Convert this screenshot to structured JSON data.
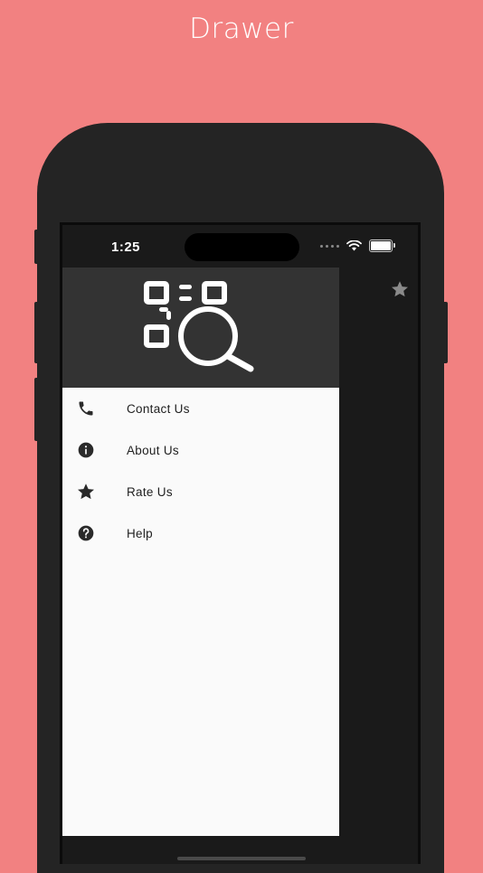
{
  "caption": "Drawer",
  "status_bar": {
    "time": "1:25"
  },
  "header": {
    "logo_icon": "qr-search-icon"
  },
  "menu": {
    "items": [
      {
        "label": "Contact Us",
        "icon": "phone-icon"
      },
      {
        "label": "About Us",
        "icon": "info-icon"
      },
      {
        "label": "Rate Us",
        "icon": "star-icon"
      },
      {
        "label": "Help",
        "icon": "help-icon"
      }
    ]
  },
  "colors": {
    "background": "#f28181",
    "drawer_header": "#333333",
    "drawer_body": "#fafafa",
    "app_background": "#1a1a1a"
  }
}
